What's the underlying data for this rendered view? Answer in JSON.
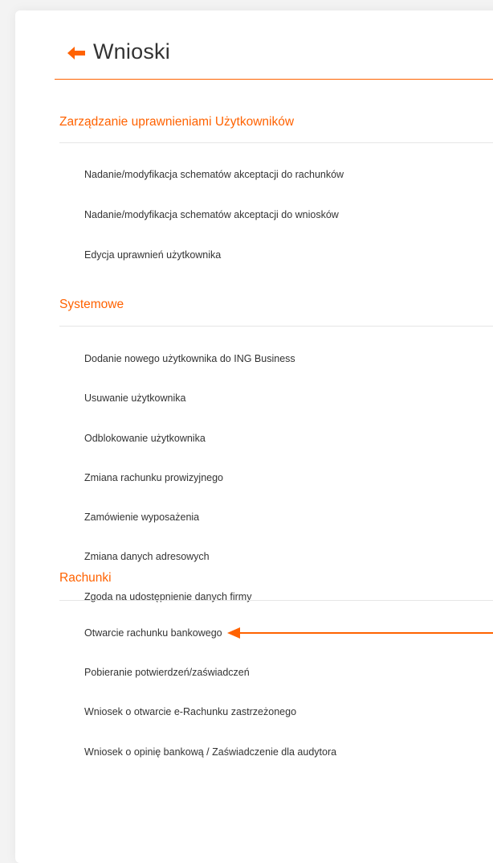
{
  "header": {
    "title": "Wnioski",
    "back_icon": "arrow-back-icon",
    "accent_color": "#ff6200"
  },
  "sections": [
    {
      "title": "Zarządzanie uprawnieniami Użytkowników",
      "items": [
        "Nadanie/modyfikacja schematów akceptacji do rachunków",
        "Nadanie/modyfikacja schematów akceptacji do wniosków",
        "Edycja uprawnień użytkownika"
      ]
    },
    {
      "title": "Systemowe",
      "items": [
        "Dodanie nowego użytkownika do ING Business",
        "Usuwanie użytkownika",
        "Odblokowanie użytkownika",
        "Zmiana rachunku prowizyjnego",
        "Zamówienie wyposażenia",
        "Zmiana danych adresowych",
        "Zgoda na udostępnienie danych firmy"
      ]
    },
    {
      "title": "Rachunki",
      "items": [
        "Otwarcie rachunku bankowego",
        "Pobieranie potwierdzeń/zaświadczeń",
        "Wniosek o otwarcie e-Rachunku zastrzeżonego",
        "Wniosek o opinię bankową / Zaświadczenie dla audytora"
      ]
    }
  ],
  "annotation": {
    "icon": "annotation-arrow-icon",
    "color": "#ff6200"
  }
}
